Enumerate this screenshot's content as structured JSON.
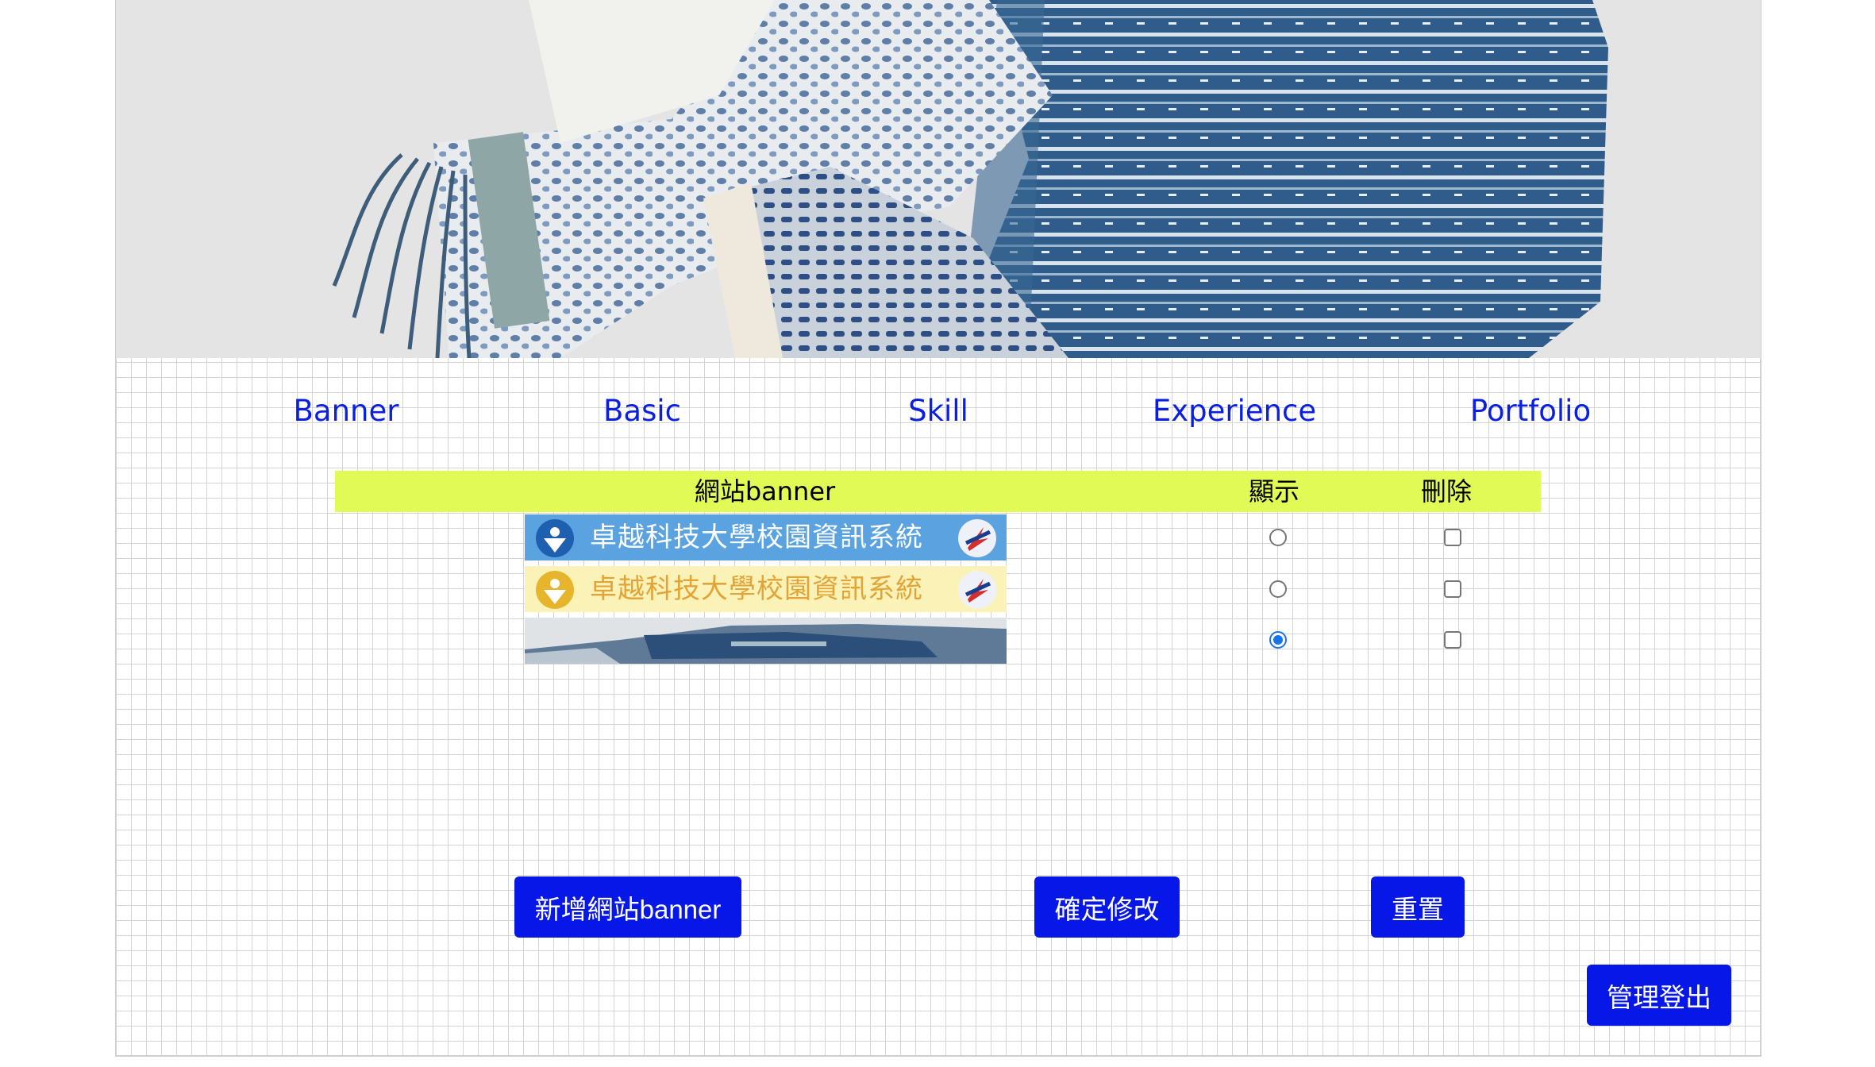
{
  "nav": {
    "items": [
      {
        "label": "Banner"
      },
      {
        "label": "Basic"
      },
      {
        "label": "Skill"
      },
      {
        "label": "Experience"
      },
      {
        "label": "Portfolio"
      }
    ]
  },
  "table": {
    "headers": {
      "banner": "網站banner",
      "show": "顯示",
      "delete": "刪除"
    },
    "rows": [
      {
        "banner_text": "卓越科技大學校園資訊系統",
        "banner_style": "blue",
        "show": false,
        "delete": false
      },
      {
        "banner_text": "卓越科技大學校園資訊系統",
        "banner_style": "yellow",
        "show": false,
        "delete": false
      },
      {
        "banner_text": "",
        "banner_style": "photo",
        "show": true,
        "delete": false
      }
    ]
  },
  "buttons": {
    "add": "新增網站banner",
    "confirm": "確定修改",
    "reset": "重置",
    "logout": "管理登出"
  },
  "colors": {
    "accent_blue": "#0717e8",
    "link_blue": "#0b1fe3",
    "header_yellow": "#e2fa55",
    "radio_selected": "#1a73e8"
  }
}
